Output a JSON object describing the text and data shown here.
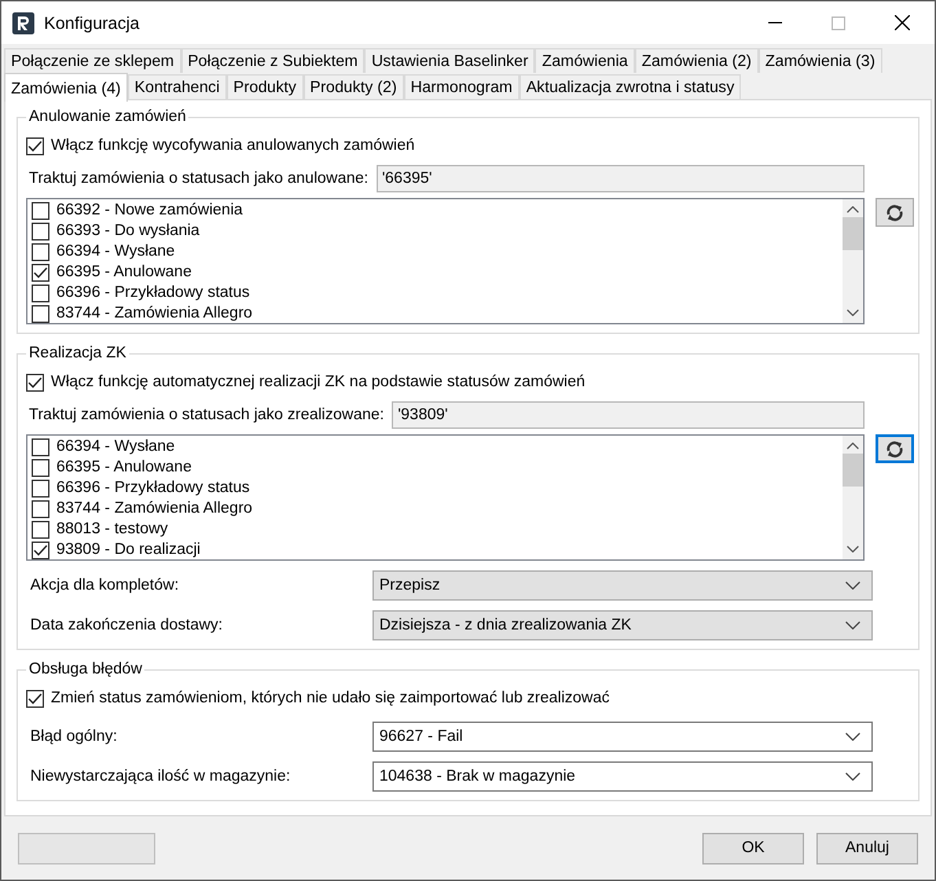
{
  "window": {
    "title": "Konfiguracja"
  },
  "tab_rows": [
    {
      "tabs": [
        {
          "label": "Połączenie ze sklepem",
          "selected": false
        },
        {
          "label": "Połączenie z Subiektem",
          "selected": false
        },
        {
          "label": "Ustawienia Baselinker",
          "selected": false
        },
        {
          "label": "Zamówienia",
          "selected": false
        },
        {
          "label": "Zamówienia (2)",
          "selected": false
        },
        {
          "label": "Zamówienia (3)",
          "selected": false
        }
      ]
    },
    {
      "tabs": [
        {
          "label": "Zamówienia (4)",
          "selected": true
        },
        {
          "label": "Kontrahenci",
          "selected": false
        },
        {
          "label": "Produkty",
          "selected": false
        },
        {
          "label": "Produkty (2)",
          "selected": false
        },
        {
          "label": "Harmonogram",
          "selected": false
        },
        {
          "label": "Aktualizacja zwrotna i statusy",
          "selected": false
        }
      ]
    }
  ],
  "groups": [
    {
      "title": "Anulowanie zamówień",
      "enable": {
        "label": "Włącz funkcję wycofywania anulowanych zamówień",
        "checked": true
      },
      "status_field": {
        "label": "Traktuj zamówienia o statusach jako anulowane:",
        "value": "'66395'"
      },
      "status_list": {
        "refresh_focused": false,
        "items": [
          {
            "label": "66392 - Nowe zamówienia",
            "checked": false
          },
          {
            "label": "66393 - Do wysłania",
            "checked": false
          },
          {
            "label": "66394 - Wysłane",
            "checked": false
          },
          {
            "label": "66395 - Anulowane",
            "checked": true
          },
          {
            "label": "66396 - Przykładowy status",
            "checked": false
          },
          {
            "label": "83744 - Zamówienia Allegro",
            "checked": false
          }
        ]
      }
    },
    {
      "title": "Realizacja ZK",
      "enable": {
        "label": "Włącz funkcję automatycznej realizacji ZK na podstawie statusów zamówień",
        "checked": true
      },
      "status_field": {
        "label": "Traktuj zamówienia o statusach jako zrealizowane:",
        "value": "'93809'"
      },
      "status_list": {
        "refresh_focused": true,
        "items": [
          {
            "label": "66394 - Wysłane",
            "checked": false
          },
          {
            "label": "66395 - Anulowane",
            "checked": false
          },
          {
            "label": "66396 - Przykładowy status",
            "checked": false
          },
          {
            "label": "83744 - Zamówienia Allegro",
            "checked": false
          },
          {
            "label": "88013 - testowy",
            "checked": false
          },
          {
            "label": "93809 - Do realizacji",
            "checked": true
          }
        ]
      },
      "dropdowns": [
        {
          "label": "Akcja dla kompletów:",
          "value": "Przepisz",
          "kind": "list"
        },
        {
          "label": "Data zakończenia dostawy:",
          "value": "Dzisiejsza - z dnia zrealizowania ZK",
          "kind": "list"
        }
      ]
    },
    {
      "title": "Obsługa błędów",
      "enable": {
        "label": "Zmień status zamówieniom, których nie udało się zaimportować lub zrealizować",
        "checked": true
      },
      "dropdowns": [
        {
          "label": "Błąd ogólny:",
          "value": "96627 - Fail",
          "kind": "combo"
        },
        {
          "label": "Niewystarczająca ilość w magazynie:",
          "value": "104638 - Brak w magazynie",
          "kind": "combo"
        }
      ]
    }
  ],
  "buttons": [
    {
      "label": "OK"
    },
    {
      "label": "Anuluj"
    }
  ]
}
